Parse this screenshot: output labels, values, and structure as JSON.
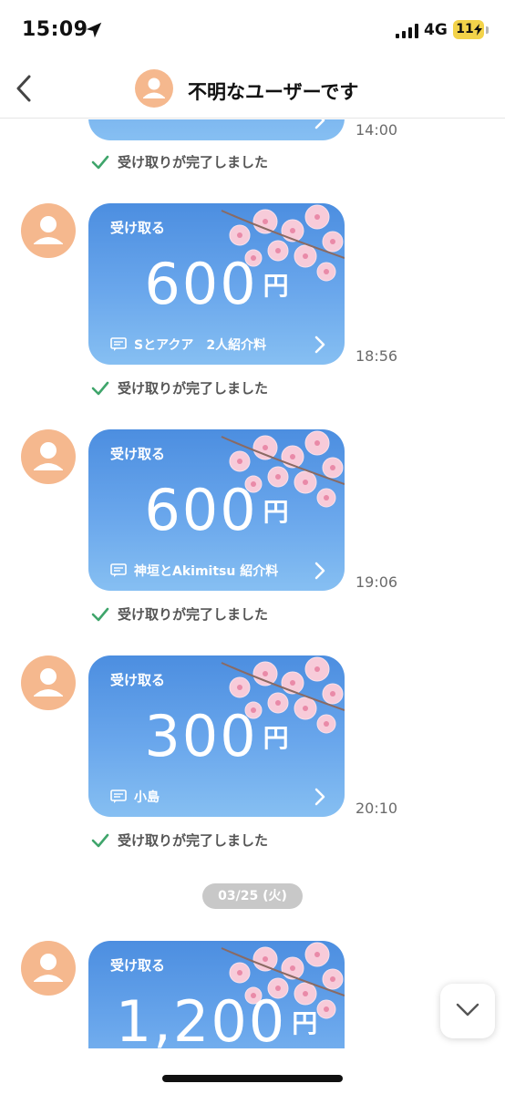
{
  "status_bar": {
    "time": "15:09",
    "network": "4G",
    "battery": "11"
  },
  "header": {
    "title": "不明なユーザーです",
    "back_icon": "chevron-left-icon",
    "avatar_icon": "user-avatar-icon"
  },
  "messages": [
    {
      "time": "14:00",
      "receipt": "受け取りが完了しました"
    },
    {
      "label": "受け取る",
      "amount": "600",
      "currency": "円",
      "memo": "Sとアクア　2人紹介料",
      "time": "18:56",
      "receipt": "受け取りが完了しました"
    },
    {
      "label": "受け取る",
      "amount": "600",
      "currency": "円",
      "memo": "神垣とAkimitsu 紹介料",
      "time": "19:06",
      "receipt": "受け取りが完了しました"
    },
    {
      "label": "受け取る",
      "amount": "300",
      "currency": "円",
      "memo": "小島",
      "time": "20:10",
      "receipt": "受け取りが完了しました"
    },
    {
      "label": "受け取る",
      "amount": "1,200",
      "currency": "円"
    }
  ],
  "date_separator": "03/25 (火)",
  "colors": {
    "card_top": "#4c8ee0",
    "card_bottom": "#86bff2",
    "avatar": "#f5b88e",
    "check": "#3fa56b"
  }
}
